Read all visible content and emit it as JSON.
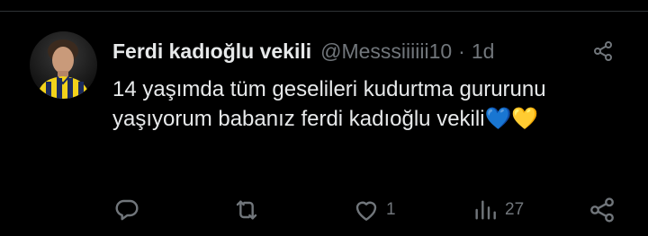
{
  "tweet": {
    "display_name": "Ferdi kadıoğlu vekili",
    "handle": "@Messsiiiiii10",
    "separator": "·",
    "time": "1d",
    "text": "14 yaşımda tüm geselileri kudurtma gururunu yaşıyorum babanız ferdi kadıoğlu vekili💙💛",
    "avatar_icon": "profile-photo"
  },
  "actions": {
    "reply_icon": "reply-icon",
    "retweet_icon": "retweet-icon",
    "like_icon": "heart-icon",
    "like_count": "1",
    "views_icon": "views-icon",
    "views_count": "27",
    "share_icon": "share-icon"
  },
  "colors": {
    "background": "#000000",
    "text_primary": "#e7e9ea",
    "text_secondary": "#71767b",
    "divider": "#2f3336"
  }
}
